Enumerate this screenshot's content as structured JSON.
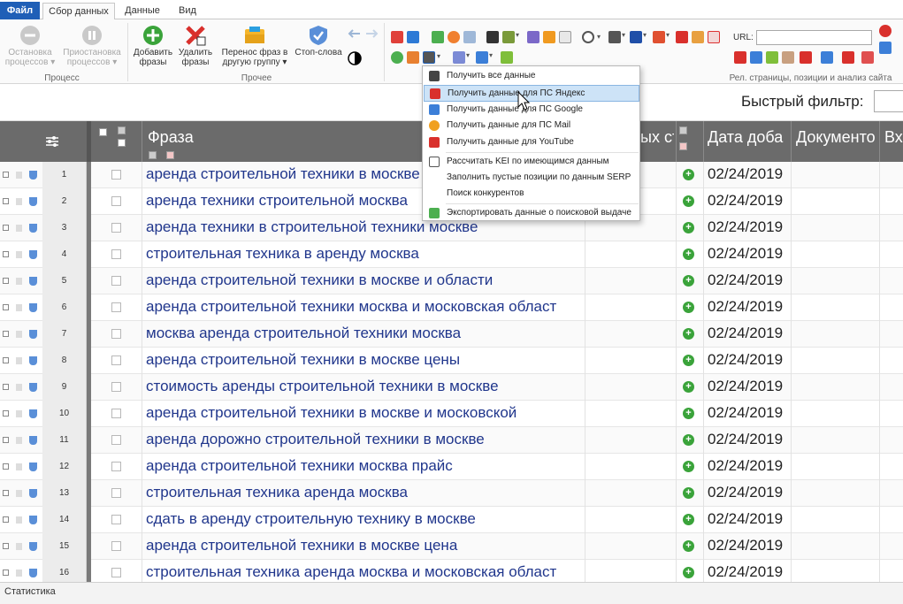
{
  "tabs": [
    "Файл",
    "Сбор данных",
    "Данные",
    "Вид"
  ],
  "ribbon": {
    "stop_label": "Остановка процессов",
    "pause_label": "Приостановка процессов",
    "process_group": "Процесс",
    "add_label": "Добавить фразы",
    "delete_label": "Удалить фразы",
    "move_label": "Перенос фраз в другую группу",
    "stopwords_label": "Стоп-слова",
    "other_group": "Прочее",
    "url_label": "URL:",
    "rel_group": "Рел. страницы, позиции и анализ сайта"
  },
  "filter": {
    "label": "Быстрый фильтр:"
  },
  "columns": {
    "phrase": "Фраза",
    "col_hidden": "ых ст",
    "date": "Дата доба",
    "docs": "Документо",
    "extra": "Вх"
  },
  "rows": [
    {
      "num": "1",
      "phrase": "аренда строительной техники в москве",
      "date": "02/24/2019"
    },
    {
      "num": "2",
      "phrase": "аренда техники строительной москва",
      "date": "02/24/2019"
    },
    {
      "num": "3",
      "phrase": "аренда техники в строительной техники москве",
      "date": "02/24/2019"
    },
    {
      "num": "4",
      "phrase": "строительная техника в аренду москва",
      "date": "02/24/2019"
    },
    {
      "num": "5",
      "phrase": "аренда строительной техники в москве и области",
      "date": "02/24/2019"
    },
    {
      "num": "6",
      "phrase": "аренда строительной техники москва и московская област",
      "date": "02/24/2019"
    },
    {
      "num": "7",
      "phrase": "москва аренда строительной техники москва",
      "date": "02/24/2019"
    },
    {
      "num": "8",
      "phrase": "аренда строительной техники в москве цены",
      "date": "02/24/2019"
    },
    {
      "num": "9",
      "phrase": "стоимость аренды строительной техники в москве",
      "date": "02/24/2019"
    },
    {
      "num": "10",
      "phrase": "аренда строительной техники в москве и московской",
      "date": "02/24/2019"
    },
    {
      "num": "11",
      "phrase": "аренда дорожно строительной техники в москве",
      "date": "02/24/2019"
    },
    {
      "num": "12",
      "phrase": "аренда строительной техники москва прайс",
      "date": "02/24/2019"
    },
    {
      "num": "13",
      "phrase": "строительная техника аренда москва",
      "date": "02/24/2019"
    },
    {
      "num": "14",
      "phrase": "сдать в аренду строительную технику в москве",
      "date": "02/24/2019"
    },
    {
      "num": "15",
      "phrase": "аренда строительной техники в москве цена",
      "date": "02/24/2019"
    },
    {
      "num": "16",
      "phrase": "строительная техника аренда москва и московская област",
      "date": "02/24/2019"
    }
  ],
  "menu": {
    "items": [
      "Получить все данные",
      "Получить данные для ПС Яндекс",
      "Получить данные для ПС Google",
      "Получить данные для ПС Mail",
      "Получить данные для YouTube",
      "Рассчитать KEI по имеющимся данным",
      "Заполнить пустые позиции по данным SERP",
      "Поиск конкурентов",
      "Экспортировать данные о поисковой выдаче"
    ]
  },
  "status": {
    "label": "Статистика"
  },
  "colors": {
    "file_tab": "#1f5fb7",
    "header": "#6b6b6b",
    "phrase_text": "#20368c",
    "highlight": "#cde3f7"
  }
}
